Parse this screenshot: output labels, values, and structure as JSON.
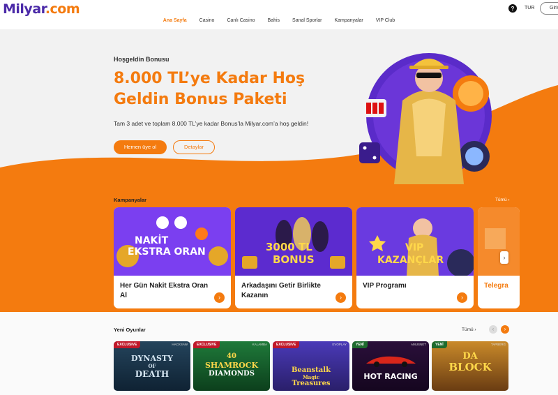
{
  "header": {
    "logo_text": "Milyar",
    "logo_suffix": ".com",
    "nav": [
      "Ana Sayfa",
      "Casino",
      "Canlı Casino",
      "Bahis",
      "Sanal Sporlar",
      "Kampanyalar",
      "VIP Club"
    ],
    "help_glyph": "?",
    "language": "TUR",
    "login_label": "Giriş"
  },
  "hero": {
    "kicker": "Hoşgeldin Bonusu",
    "title": "8.000 TL’ye Kadar Hoş Geldin Bonus Paketi",
    "subtitle": "Tam 3 adet ve toplam 8.000 TL’ye kadar Bonus’la Milyar.com’a hoş geldin!",
    "join_label": "Hemen üye ol",
    "details_label": "Detaylar"
  },
  "campaigns": {
    "title": "Kampanyalar",
    "see_all": "Tümü ›",
    "next_glyph": "›",
    "cards": [
      {
        "art_text_1": "NAKİT",
        "art_text_2": "EKSTRA ORAN",
        "title": "Her Gün Nakit Ekstra Oran Al"
      },
      {
        "art_text_1": "3000 TL",
        "art_text_2": "BONUS",
        "title": "Arkadaşını Getir Birlikte Kazanın"
      },
      {
        "art_text_1": "VIP",
        "art_text_2": "KAZANÇLAR",
        "title": "VIP Programı"
      },
      {
        "art_text_1": "",
        "art_text_2": "",
        "title": "Telegra"
      }
    ]
  },
  "games": {
    "title": "Yeni Oyunlar",
    "see_all": "Tümü ›",
    "prev_glyph": "‹",
    "next_glyph": "›",
    "items": [
      {
        "badge": "EXCLUSIVE",
        "provider": "HACKSAW",
        "art_1": "DYNASTY",
        "art_2": "OF",
        "art_3": "DEATH"
      },
      {
        "badge": "EXCLUSIVE",
        "provider": "KALAMBA",
        "art_1": "40",
        "art_2": "SHAMROCK",
        "art_3": "DIAMONDS"
      },
      {
        "badge": "EXCLUSIVE",
        "provider": "EVOPLAY",
        "art_1": "Beanstalk",
        "art_2": "Magic",
        "art_3": "Treasures"
      },
      {
        "badge": "YENİ",
        "provider": "AMUSNET",
        "art_1": "HOT RACING",
        "art_2": "",
        "art_3": ""
      },
      {
        "badge": "YENİ",
        "provider": "TAPBERG",
        "art_1": "DA",
        "art_2": "BLOCK",
        "art_3": ""
      }
    ]
  },
  "colors": {
    "accent": "#f47b0f",
    "brand": "#4b2aa8",
    "exclusive_badge": "#c0182a",
    "new_badge": "#1e6b2e"
  }
}
